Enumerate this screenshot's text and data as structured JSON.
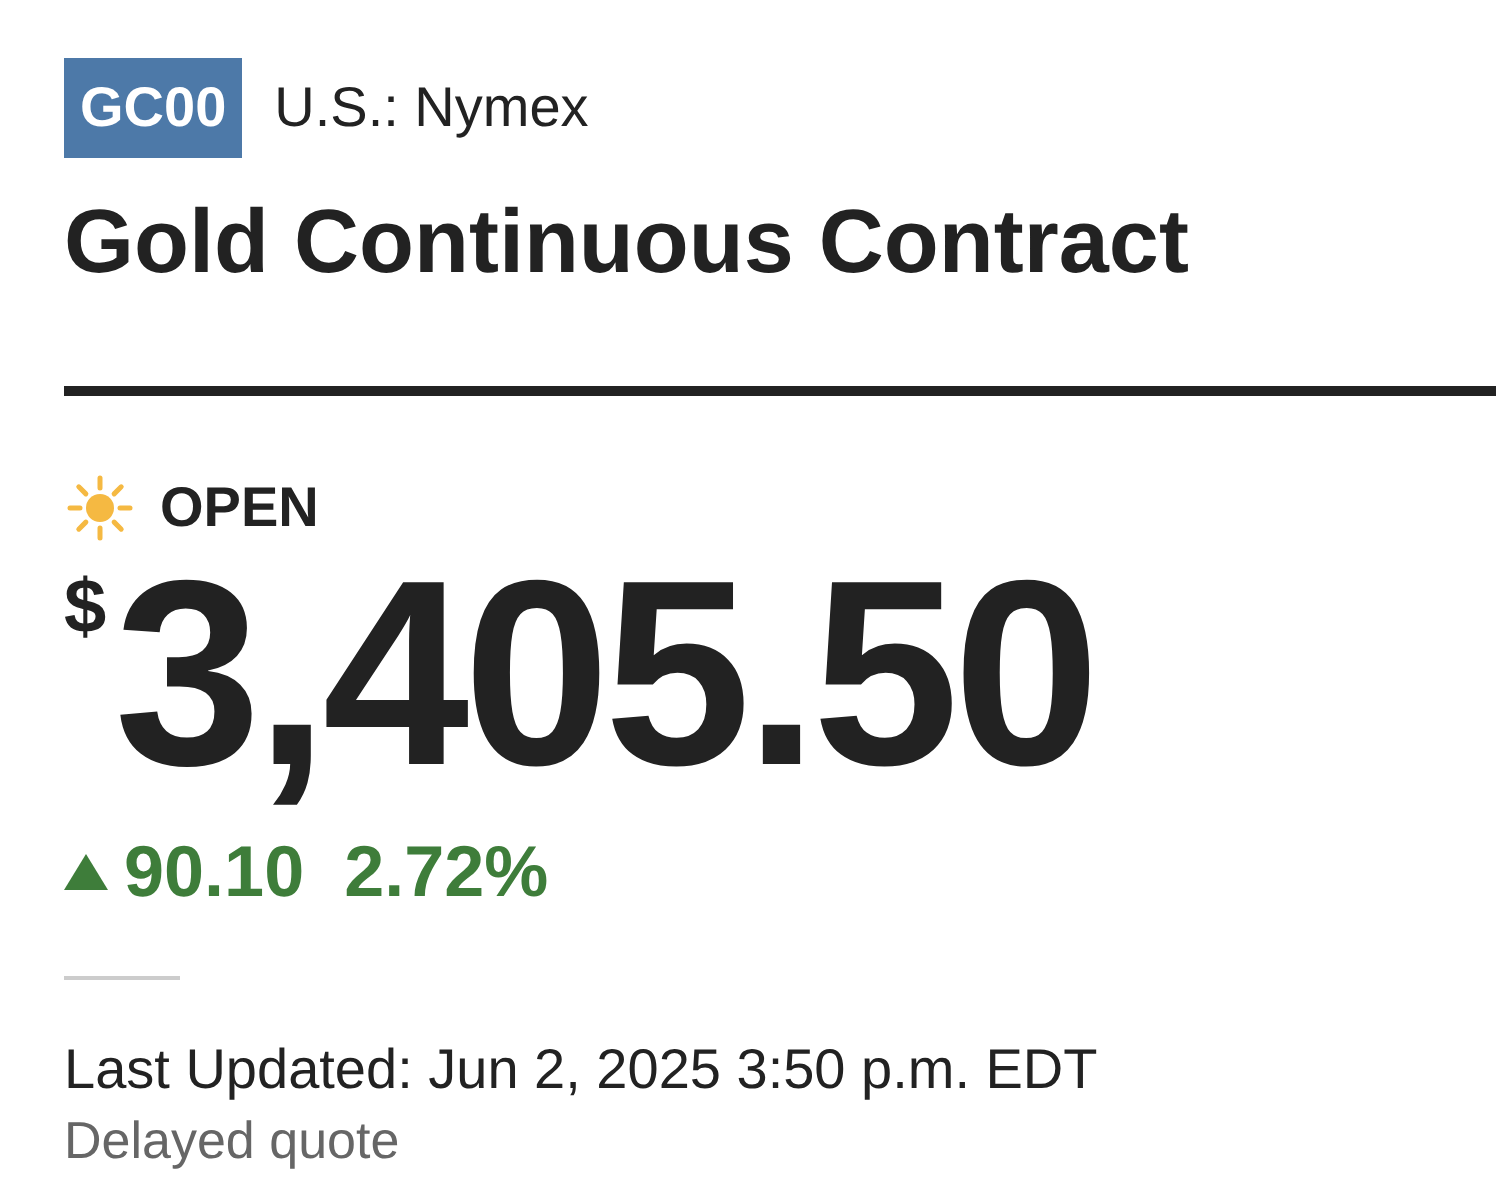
{
  "symbol": "GC00",
  "exchange": "U.S.: Nymex",
  "title": "Gold Continuous Contract",
  "status": {
    "kind": "open",
    "label": "OPEN"
  },
  "price": {
    "currency": "$",
    "value": "3,405.50"
  },
  "change": {
    "kind": "up",
    "amount": "90.10",
    "percent": "2.72%"
  },
  "last_updated": "Last Updated: Jun 2, 2025 3:50 p.m. EDT",
  "note": "Delayed quote"
}
